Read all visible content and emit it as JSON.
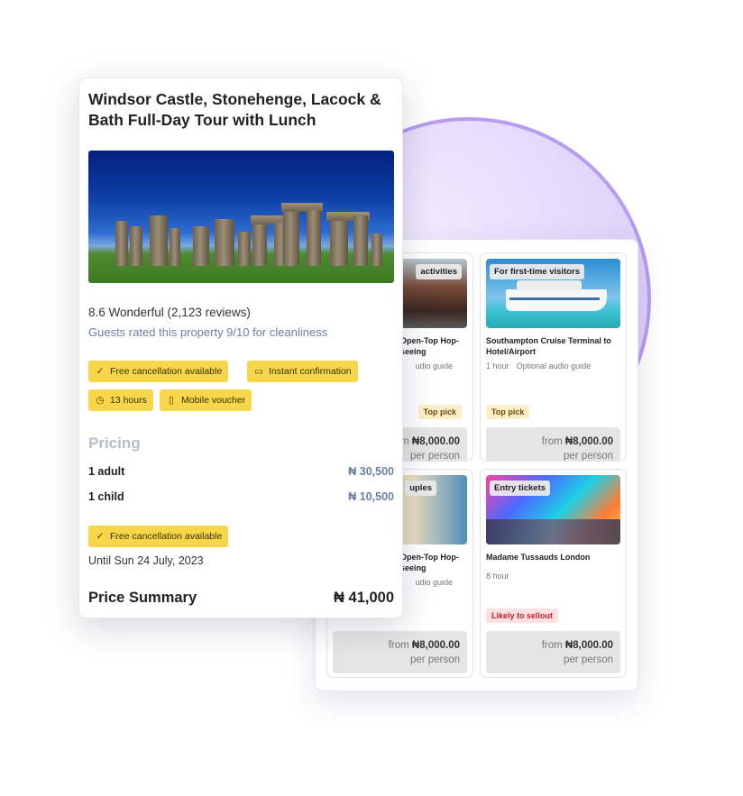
{
  "tour": {
    "title": "Windsor Castle, Stonehenge, Lacock & Bath Full-Day Tour with Lunch",
    "rating": "8.6 Wonderful (2,123 reviews)",
    "guest_note": "Guests rated this property 9/10 for cleanliness",
    "chips": [
      {
        "icon": "check-icon",
        "label": "Free cancellation available"
      },
      {
        "icon": "ticket-icon",
        "label": "Instant confirmation"
      },
      {
        "icon": "clock-icon",
        "label": "13 hours"
      },
      {
        "icon": "phone-icon",
        "label": "Mobile voucher"
      }
    ],
    "pricing": {
      "heading": "Pricing",
      "rows": [
        {
          "label": "1 adult",
          "value": "₦ 30,500"
        },
        {
          "label": "1 child",
          "value": "₦ 10,500"
        }
      ],
      "cancel_chip": "Free cancellation available",
      "until": "Until Sun 24 July, 2023"
    },
    "summary": {
      "label": "Price Summary",
      "value": "₦ 41,000"
    }
  },
  "activities": [
    {
      "tag": "activities",
      "title": "Open-Top Hop-\nseeing",
      "meta": [
        "udio guide"
      ],
      "badge": "Top pick",
      "badge_type": "pick",
      "price_from": "from",
      "price": "₦8,000.00",
      "per": "per person"
    },
    {
      "tag": "For first-time visitors",
      "title": "Southampton Cruise Terminal to Hotel/Airport",
      "meta": [
        "1 hour",
        "Optional audio guide"
      ],
      "badge": "Top pick",
      "badge_type": "pick",
      "price_from": "from",
      "price": "₦8,000.00",
      "per": "per person"
    },
    {
      "tag": "uples",
      "title": "Open-Top Hop-\nseeing",
      "meta": [
        "udio guide"
      ],
      "badge": "",
      "badge_type": "pick",
      "price_from": "from",
      "price": "₦8,000.00",
      "per": "per person"
    },
    {
      "tag": "Entry tickets",
      "title": "Madame Tussauds London",
      "meta": [
        "8 hour"
      ],
      "badge": "Likely to sellout",
      "badge_type": "sell",
      "price_from": "from",
      "price": "₦8,000.00",
      "per": "per person"
    }
  ],
  "colors": {
    "accent_yellow": "#f7d64a",
    "circle_purple": "#b79cf0",
    "muted_blue": "#6d7fa3"
  }
}
